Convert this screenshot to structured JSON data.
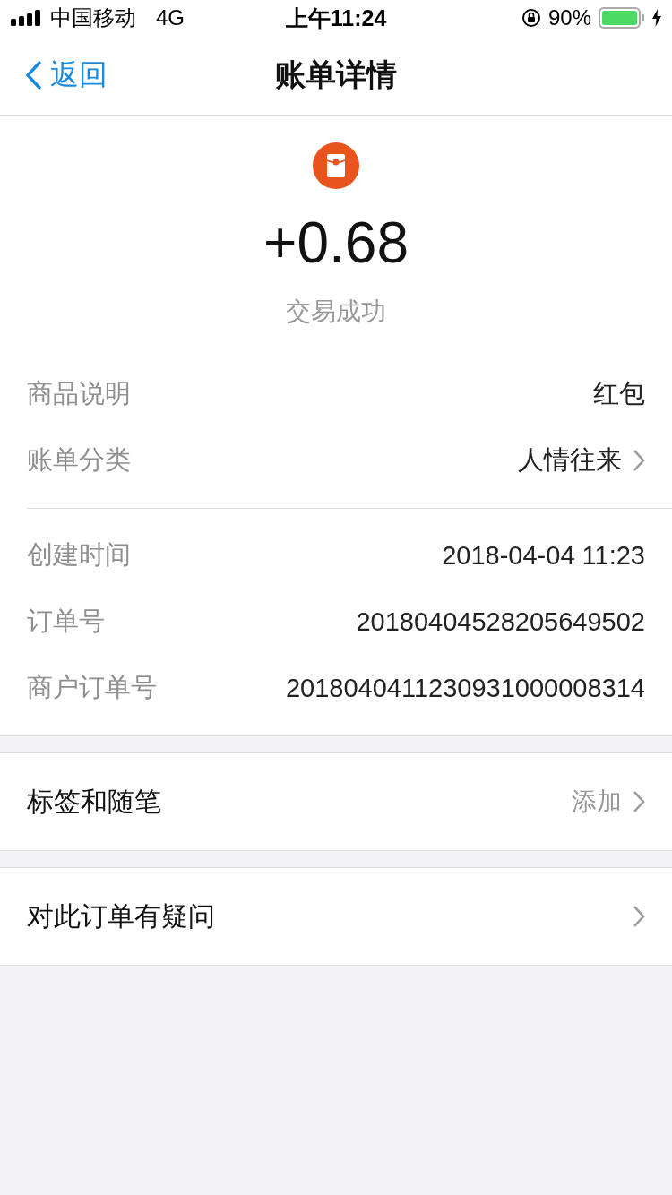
{
  "status_bar": {
    "carrier": "中国移动",
    "network": "4G",
    "time": "上午11:24",
    "battery": "90%"
  },
  "nav": {
    "back": "返回",
    "title": "账单详情"
  },
  "summary": {
    "amount": "+0.68",
    "status": "交易成功"
  },
  "detail_groups": [
    {
      "rows": [
        {
          "label": "商品说明",
          "value": "红包",
          "chevron": false
        },
        {
          "label": "账单分类",
          "value": "人情往来",
          "chevron": true
        }
      ]
    },
    {
      "rows": [
        {
          "label": "创建时间",
          "value": "2018-04-04 11:23",
          "chevron": false
        },
        {
          "label": "订单号",
          "value": "20180404528205649502",
          "chevron": false
        },
        {
          "label": "商户订单号",
          "value": "2018040411230931000008314",
          "chevron": false
        }
      ]
    }
  ],
  "actions": [
    {
      "label": "标签和随笔",
      "value": "添加",
      "chevron": true
    },
    {
      "label": "对此订单有疑问",
      "chevron": true
    }
  ]
}
